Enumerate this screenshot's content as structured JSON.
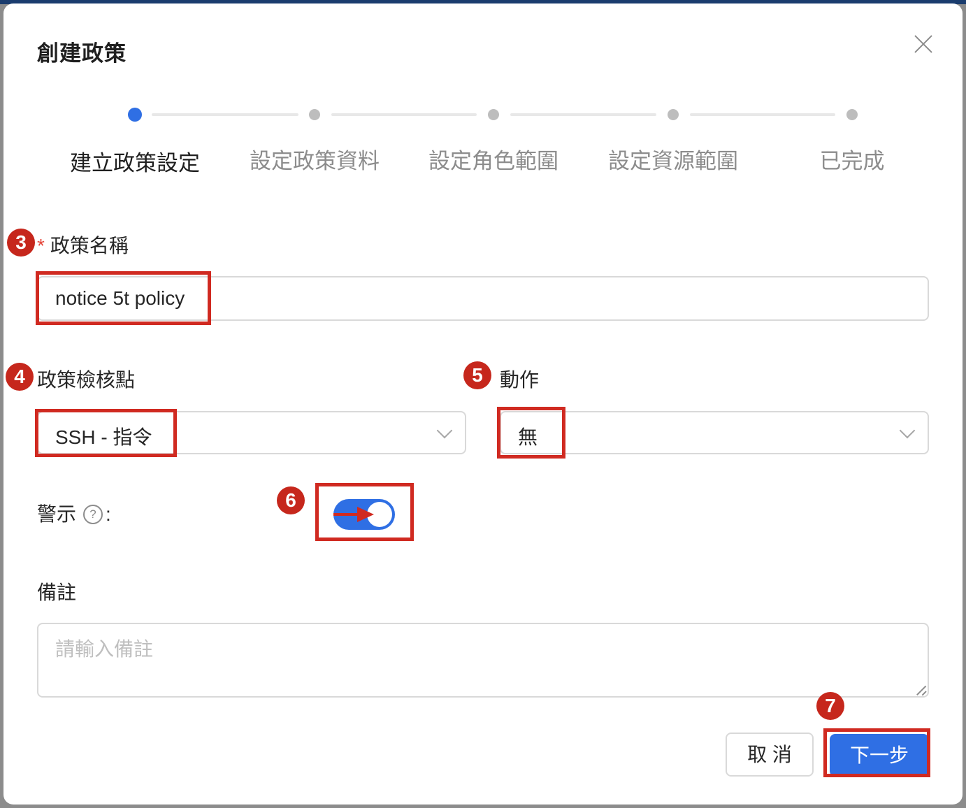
{
  "dialog": {
    "title": "創建政策"
  },
  "steps": [
    {
      "label": "建立政策設定",
      "state": "current"
    },
    {
      "label": "設定政策資料",
      "state": "pending"
    },
    {
      "label": "設定角色範圍",
      "state": "pending"
    },
    {
      "label": "設定資源範圍",
      "state": "pending"
    },
    {
      "label": "已完成",
      "state": "pending"
    }
  ],
  "annotations": {
    "n3": "3",
    "n4": "4",
    "n5": "5",
    "n6": "6",
    "n7": "7"
  },
  "form": {
    "policy_name": {
      "required_mark": "*",
      "label": "政策名稱",
      "value": "notice 5t policy"
    },
    "checkpoint": {
      "label": "政策檢核點",
      "value": "SSH - 指令"
    },
    "action": {
      "label": "動作",
      "value": "無"
    },
    "alert": {
      "label": "警示",
      "help_icon": "?",
      "colon": ":",
      "enabled": true
    },
    "remark": {
      "label": "備註",
      "placeholder": "請輸入備註"
    }
  },
  "buttons": {
    "cancel": "取 消",
    "next": "下一步"
  },
  "colors": {
    "primary": "#2f6fe4",
    "annotation_red": "#c6271c",
    "required": "#e5483d"
  }
}
